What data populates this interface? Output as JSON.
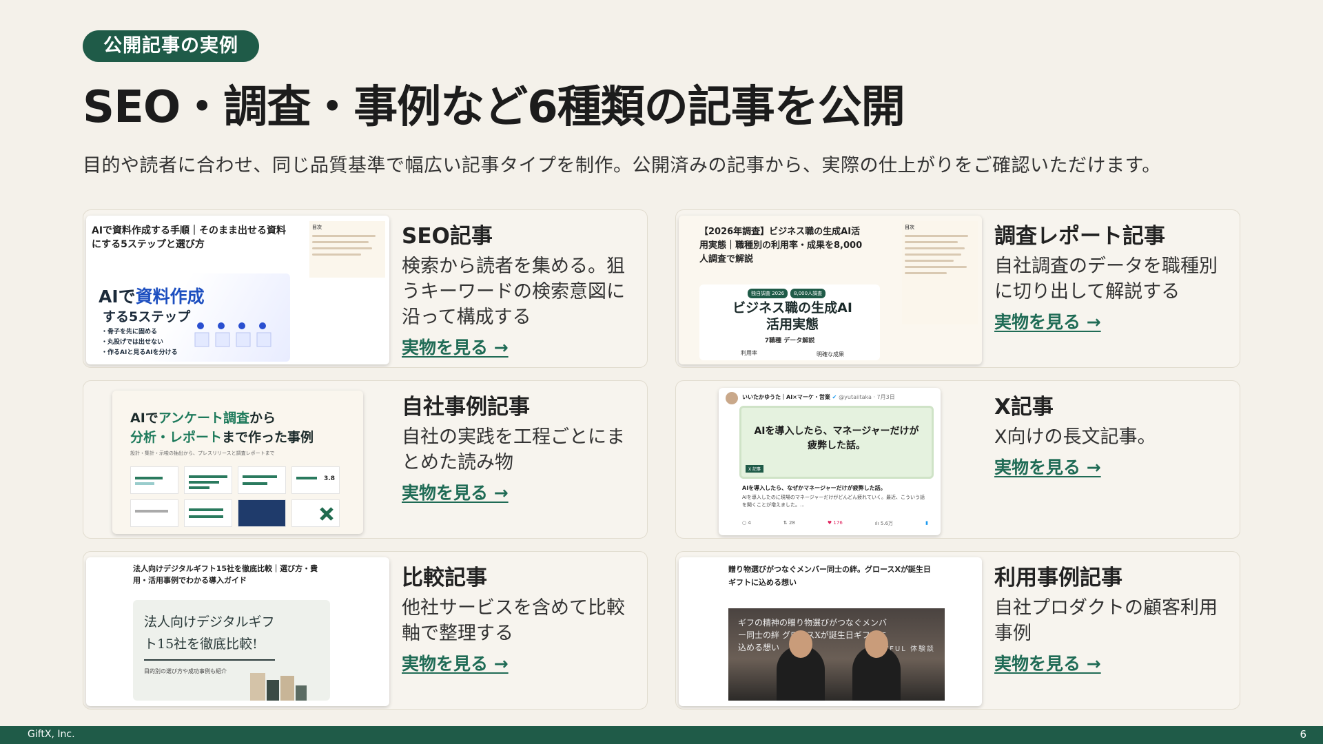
{
  "header": {
    "badge": "公開記事の実例",
    "title": "SEO・調査・事例など6種類の記事を公開",
    "subtitle": "目的や読者に合わせ、同じ品質基準で幅広い記事タイプを制作。公開済みの記事から、実際の仕上がりをご確認いただけます。"
  },
  "cards": [
    {
      "title": "SEO記事",
      "desc": "検索から読者を集める。狙うキーワードの検索意図に沿って構成する",
      "link": "実物を見る →",
      "thumb": {
        "heading": "AIで資料作成する手順｜そのまま出せる資料にする5ステップと選び方",
        "hero_a": "AIで",
        "hero_hl": "資料作成",
        "hero_b": "する5ステップ",
        "bullets": [
          "・骨子を先に固める",
          "・丸投げでは出せない",
          "・作るAIと見るAIを分ける"
        ],
        "toc_label": "目次"
      }
    },
    {
      "title": "調査レポート記事",
      "desc": "自社調査のデータを職種別に切り出して解説する",
      "link": "実物を見る →",
      "thumb": {
        "heading": "【2026年調査】ビジネス職の生成AI活用実態｜職種別の利用率・成果を8,000人調査で解説",
        "tags": [
          "独自調査 2026",
          "8,000人調査"
        ],
        "hero": "ビジネス職の生成AI活用実態",
        "hero_sub": "7職種 データ解説",
        "foot_a": "利用率",
        "foot_b": "明確な成果",
        "toc_label": "目次"
      }
    },
    {
      "title": "自社事例記事",
      "desc": "自社の実践を工程ごとにまとめた読み物",
      "link": "実物を見る →",
      "thumb": {
        "line1_a": "AIで",
        "line1_hl": "アンケート調査",
        "line1_b": "から",
        "line2_hl": "分析・レポート",
        "line2_b": "まで作った事例",
        "caption": "設計・集計・示唆の抽出から、プレスリリースと調査レポートまで"
      }
    },
    {
      "title": "X記事",
      "desc": "X向けの長文記事。",
      "link": "実物を見る →",
      "thumb": {
        "author": "いいたかゆうた｜AI×マーケ・営業",
        "handle": "@yutaiitaka · 7月3日",
        "card_title": "AIを導入したら、マネージャーだけが疲弊した話。",
        "tag": "X 記事",
        "body_title": "AIを導入したら、なぜかマネージャーだけが疲弊した話。",
        "body": "AIを導入したのに現場のマネージャーだけがどんどん疲れていく。最近、こういう話を聞くことが増えました。...",
        "stats": [
          "○ 4",
          "⇅ 28",
          "♥ 176",
          "ılı 5.6万"
        ]
      }
    },
    {
      "title": "比較記事",
      "desc": "他社サービスを含めて比較軸で整理する",
      "link": "実物を見る →",
      "thumb": {
        "heading": "法人向けデジタルギフト15社を徹底比較｜選び方・費用・活用事例でわかる導入ガイド",
        "hero": "法人向けデジタルギフト15社を徹底比較!",
        "hero_sub": "目的別の選び方や成功事例も紹介"
      }
    },
    {
      "title": "利用事例記事",
      "desc": "自社プロダクトの顧客利用事例",
      "link": "実物を見る →",
      "thumb": {
        "heading": "贈り物選びがつなぐメンバー同士の絆。グロースXが誕生日ギフトに込める想い",
        "photo_text": "ギフの精神の贈り物選びがつなぐメンバー同士の絆 グロースXが誕生日ギフトに込める想い",
        "photo_brand": "GIFTFUL 体験談"
      }
    }
  ],
  "footer": {
    "company": "GiftX, Inc.",
    "page": "6"
  },
  "colors": {
    "accent": "#1f5b48",
    "link": "#1f6b55",
    "background": "#f4f1ea"
  }
}
